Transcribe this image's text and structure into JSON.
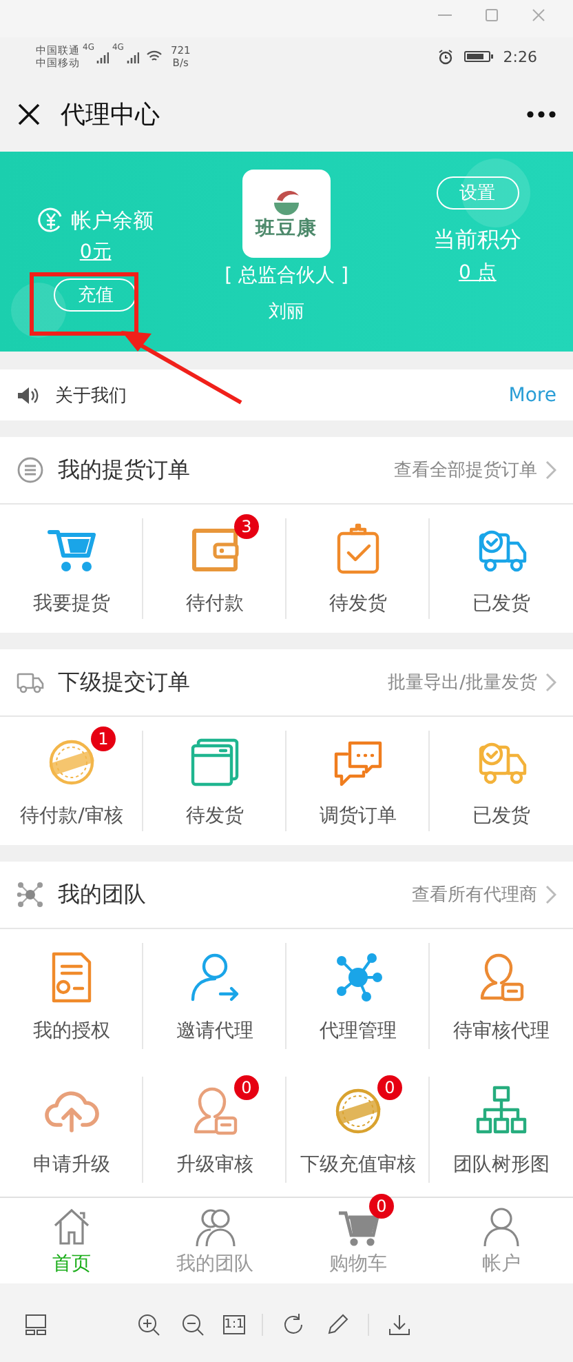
{
  "status_bar": {
    "carriers": [
      "中国联通",
      "中国移动"
    ],
    "networks": [
      "4G",
      "4G"
    ],
    "speed_value": "721",
    "speed_unit": "B/s",
    "time": "2:26"
  },
  "nav": {
    "title": "代理中心"
  },
  "profile": {
    "balance_label": "帐户余额",
    "balance": "0元",
    "recharge_button": "充值",
    "logo_text": "班豆康",
    "role": "[ 总监合伙人 ]",
    "name": "刘丽",
    "settings_button": "设置",
    "points_label": "当前积分",
    "points": "0 点"
  },
  "notice": {
    "title": "关于我们",
    "more": "More"
  },
  "sections": [
    {
      "title": "我的提货订单",
      "link": "查看全部提货订单",
      "items": [
        {
          "label": "我要提货"
        },
        {
          "label": "待付款",
          "badge": "3"
        },
        {
          "label": "待发货"
        },
        {
          "label": "已发货"
        }
      ]
    },
    {
      "title": "下级提交订单",
      "link": "批量导出/批量发货",
      "items": [
        {
          "label": "待付款/审核",
          "badge": "1"
        },
        {
          "label": "待发货"
        },
        {
          "label": "调货订单"
        },
        {
          "label": "已发货"
        }
      ]
    },
    {
      "title": "我的团队",
      "link": "查看所有代理商",
      "items": [
        {
          "label": "我的授权"
        },
        {
          "label": "邀请代理"
        },
        {
          "label": "代理管理"
        },
        {
          "label": "待审核代理"
        },
        {
          "label": "申请升级"
        },
        {
          "label": "升级审核",
          "badge": "0"
        },
        {
          "label": "下级充值审核",
          "badge": "0"
        },
        {
          "label": "团队树形图"
        }
      ]
    }
  ],
  "tab_bar": [
    {
      "label": "首页",
      "selected": true
    },
    {
      "label": "我的团队",
      "selected": false
    },
    {
      "label": "购物车",
      "selected": false,
      "badge": "0"
    },
    {
      "label": "帐户",
      "selected": false
    }
  ],
  "viewer_toolbar": {
    "actual_size": "1:1"
  }
}
